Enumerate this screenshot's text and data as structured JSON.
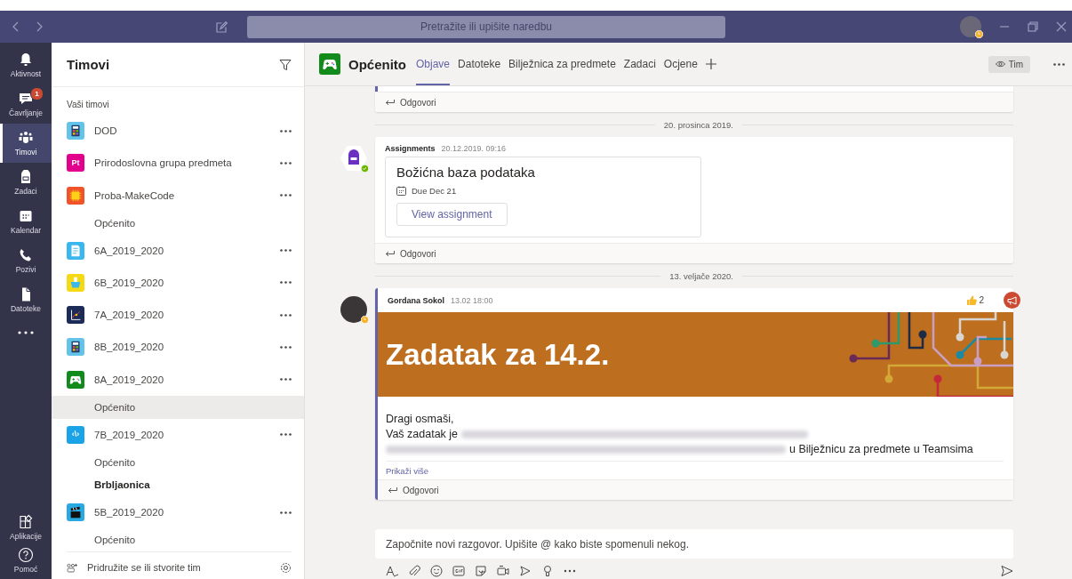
{
  "title_bar": {
    "search": {
      "placeholder": "Pretražite ili upišite naredbu"
    },
    "away": true
  },
  "app_bar": {
    "items": [
      {
        "label": "Aktivnost",
        "selected": false
      },
      {
        "label": "Čavrljanje",
        "selected": false,
        "badge": "1"
      },
      {
        "label": "Timovi",
        "selected": true
      },
      {
        "label": "Zadaci",
        "selected": false
      },
      {
        "label": "Kalendar",
        "selected": false
      },
      {
        "label": "Pozivi",
        "selected": false
      },
      {
        "label": "Datoteke",
        "selected": false
      }
    ],
    "bottom_items": [
      {
        "label": "Aplikacije",
        "selected": false
      },
      {
        "label": "Pomoć",
        "selected": false
      }
    ]
  },
  "teams_panel": {
    "title": "Timovi",
    "section": "Vaši timovi",
    "teams": [
      {
        "name": "DOD",
        "color": "#63c3e8"
      },
      {
        "name": "Prirodoslovna grupa predmeta",
        "color": "#e3008c",
        "icon_text": "Pt"
      },
      {
        "name": "Proba-MakeCode",
        "color": "#f0522a",
        "channels": [
          {
            "name": "Općenito",
            "selected": false,
            "unread": false
          }
        ]
      },
      {
        "name": "6A_2019_2020",
        "color": "#3ab7ec"
      },
      {
        "name": "6B_2019_2020",
        "color": "#f5d915"
      },
      {
        "name": "7A_2019_2020",
        "color": "#1c2b58"
      },
      {
        "name": "8B_2019_2020",
        "color": "#63c3e8"
      },
      {
        "name": "8A_2019_2020",
        "color": "#138a1c",
        "channels": [
          {
            "name": "Općenito",
            "selected": true,
            "unread": false
          }
        ]
      },
      {
        "name": "7B_2019_2020",
        "color": "#1aa3e6",
        "icon_text": "‹\\›",
        "channels": [
          {
            "name": "Općenito",
            "selected": false,
            "unread": false
          },
          {
            "name": "Brbljaonica",
            "selected": false,
            "unread": true
          }
        ]
      },
      {
        "name": "5B_2019_2020",
        "color": "#29a9e1",
        "channels": [
          {
            "name": "Općenito",
            "selected": false,
            "unread": false
          }
        ]
      }
    ],
    "footer": "Pridružite se ili stvorite tim"
  },
  "channel": {
    "name": "Općenito",
    "tabs": [
      {
        "label": "Objave",
        "selected": true
      },
      {
        "label": "Datoteke",
        "selected": false
      },
      {
        "label": "Bilježnica za predmete",
        "selected": false
      },
      {
        "label": "Zadaci",
        "selected": false
      },
      {
        "label": "Ocjene",
        "selected": false
      }
    ],
    "team_button": "Tim"
  },
  "feed": [
    {
      "kind": "partial",
      "reply": "Odgovori"
    },
    {
      "kind": "divider",
      "date": "20. prosinca 2019."
    },
    {
      "kind": "assignment",
      "author": "Assignments",
      "time": "20.12.2019. 09:16",
      "away": false,
      "title": "Božićna baza podataka",
      "due": "Due Dec 21",
      "button": "View assignment",
      "reply": "Odgovori"
    },
    {
      "kind": "divider",
      "date": "13. veljače 2020."
    },
    {
      "kind": "announcement",
      "author": "Gordana Sokol",
      "time": "13.02 18:00",
      "away": true,
      "likes": "2",
      "headline": "Zadatak za 14.2.",
      "body": [
        [
          {
            "kind": "text",
            "text": "Dragi osmaši,"
          }
        ],
        [
          {
            "kind": "text",
            "text": "Vaš zadatak je"
          },
          {
            "kind": "blurred"
          }
        ],
        [
          {
            "kind": "blurred"
          },
          {
            "kind": "text",
            "text": "u Bilježnicu za predmete u Teamsima"
          }
        ]
      ],
      "more": "Prikaži više",
      "reply": "Odgovori"
    }
  ],
  "compose": {
    "placeholder": "Započnite novi razgovor. Upišite @ kako biste spomenuli nekog."
  }
}
